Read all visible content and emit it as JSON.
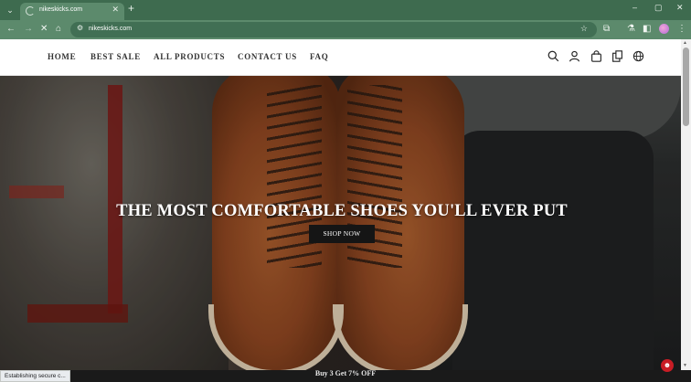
{
  "browser": {
    "tab_title": "nikeskicks.com",
    "tab_close": "✕",
    "new_tab": "+",
    "url": "nikeskicks.com",
    "window_controls": [
      "–",
      "▢",
      "✕"
    ],
    "tab_search_icon": "chevron-down-icon",
    "status_text": "Establishing secure c..."
  },
  "nav": {
    "items": [
      "HOME",
      "BEST SALE",
      "ALL PRODUCTS",
      "CONTACT US",
      "FAQ"
    ]
  },
  "hero": {
    "title": "THE MOST COMFORTABLE SHOES YOU'LL EVER PUT",
    "button": "SHOP NOW"
  },
  "promo": {
    "text": "Buy 3 Get 7% OFF"
  },
  "colors": {
    "chrome_frame": "#3e6b4f",
    "chrome_toolbar": "#5c8a6c",
    "button_bg": "#151515"
  }
}
